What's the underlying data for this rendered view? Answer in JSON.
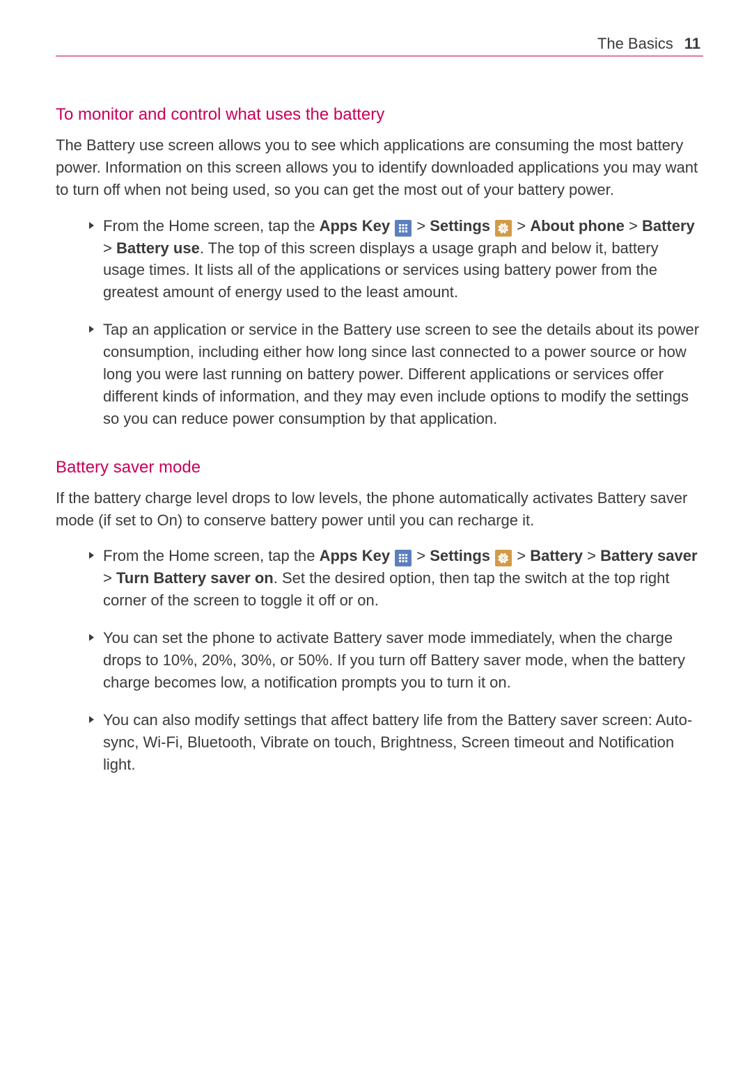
{
  "header": {
    "title": "The Basics",
    "page_number": "11"
  },
  "sections": [
    {
      "heading": "To monitor and control what uses the battery",
      "intro": "The Battery use screen allows you to see which applications are consuming the most battery power. Information on this screen allows you to identify downloaded applications you may want to turn off when not being used, so you can get the most out of your battery power.",
      "bullets": [
        {
          "frags": [
            {
              "t": "From the Home screen, tap the "
            },
            {
              "t": "Apps Key ",
              "bold": true
            },
            {
              "icon": "apps"
            },
            {
              "t": " > "
            },
            {
              "t": "Settings ",
              "bold": true
            },
            {
              "icon": "settings"
            },
            {
              "t": " > "
            },
            {
              "t": "About phone",
              "bold": true
            },
            {
              "t": " > "
            },
            {
              "t": "Battery",
              "bold": true
            },
            {
              "t": " > "
            },
            {
              "t": "Battery use",
              "bold": true
            },
            {
              "t": ". The top of this screen displays a usage graph and below it, battery usage times. It lists all of the applications or services using battery power from the greatest amount of energy used to the least amount."
            }
          ]
        },
        {
          "frags": [
            {
              "t": "Tap an application or service in the Battery use screen to see the details about its power consumption, including either how long since last connected to a power source or how long you were last running on battery power. Different applications or services offer different kinds of information, and they may even include options to modify the settings so you can reduce power consumption by that application."
            }
          ]
        }
      ]
    },
    {
      "heading": "Battery saver mode",
      "intro": "If the battery charge level drops to low levels, the phone automatically activates Battery saver mode (if set to On) to conserve battery power until you can recharge it.",
      "bullets": [
        {
          "frags": [
            {
              "t": "From the Home screen, tap the "
            },
            {
              "t": "Apps Key ",
              "bold": true
            },
            {
              "icon": "apps"
            },
            {
              "t": " > "
            },
            {
              "t": "Settings ",
              "bold": true
            },
            {
              "icon": "settings"
            },
            {
              "t": " > "
            },
            {
              "t": "Battery",
              "bold": true
            },
            {
              "t": " > "
            },
            {
              "t": "Battery saver",
              "bold": true
            },
            {
              "t": " > "
            },
            {
              "t": "Turn Battery saver on",
              "bold": true
            },
            {
              "t": ". Set the desired option, then tap the switch at the top right corner of the screen to toggle it off or on."
            }
          ]
        },
        {
          "frags": [
            {
              "t": "You can set the phone to activate Battery saver mode immediately, when the charge drops to 10%, 20%, 30%, or 50%. If you turn off Battery saver mode, when the battery charge becomes low, a notification prompts you to turn it on."
            }
          ]
        },
        {
          "frags": [
            {
              "t": "You can also modify settings that affect battery life from the Battery saver screen: Auto-sync, Wi-Fi, Bluetooth, Vibrate on touch, Brightness, Screen timeout and Notification light."
            }
          ]
        }
      ]
    }
  ]
}
